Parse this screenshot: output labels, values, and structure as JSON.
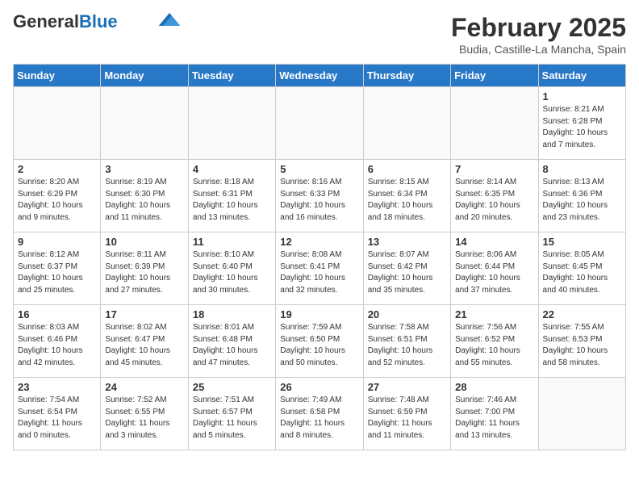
{
  "header": {
    "logo_general": "General",
    "logo_blue": "Blue",
    "month_title": "February 2025",
    "location": "Budia, Castille-La Mancha, Spain"
  },
  "weekdays": [
    "Sunday",
    "Monday",
    "Tuesday",
    "Wednesday",
    "Thursday",
    "Friday",
    "Saturday"
  ],
  "weeks": [
    [
      {
        "day": "",
        "info": ""
      },
      {
        "day": "",
        "info": ""
      },
      {
        "day": "",
        "info": ""
      },
      {
        "day": "",
        "info": ""
      },
      {
        "day": "",
        "info": ""
      },
      {
        "day": "",
        "info": ""
      },
      {
        "day": "1",
        "info": "Sunrise: 8:21 AM\nSunset: 6:28 PM\nDaylight: 10 hours and 7 minutes."
      }
    ],
    [
      {
        "day": "2",
        "info": "Sunrise: 8:20 AM\nSunset: 6:29 PM\nDaylight: 10 hours and 9 minutes."
      },
      {
        "day": "3",
        "info": "Sunrise: 8:19 AM\nSunset: 6:30 PM\nDaylight: 10 hours and 11 minutes."
      },
      {
        "day": "4",
        "info": "Sunrise: 8:18 AM\nSunset: 6:31 PM\nDaylight: 10 hours and 13 minutes."
      },
      {
        "day": "5",
        "info": "Sunrise: 8:16 AM\nSunset: 6:33 PM\nDaylight: 10 hours and 16 minutes."
      },
      {
        "day": "6",
        "info": "Sunrise: 8:15 AM\nSunset: 6:34 PM\nDaylight: 10 hours and 18 minutes."
      },
      {
        "day": "7",
        "info": "Sunrise: 8:14 AM\nSunset: 6:35 PM\nDaylight: 10 hours and 20 minutes."
      },
      {
        "day": "8",
        "info": "Sunrise: 8:13 AM\nSunset: 6:36 PM\nDaylight: 10 hours and 23 minutes."
      }
    ],
    [
      {
        "day": "9",
        "info": "Sunrise: 8:12 AM\nSunset: 6:37 PM\nDaylight: 10 hours and 25 minutes."
      },
      {
        "day": "10",
        "info": "Sunrise: 8:11 AM\nSunset: 6:39 PM\nDaylight: 10 hours and 27 minutes."
      },
      {
        "day": "11",
        "info": "Sunrise: 8:10 AM\nSunset: 6:40 PM\nDaylight: 10 hours and 30 minutes."
      },
      {
        "day": "12",
        "info": "Sunrise: 8:08 AM\nSunset: 6:41 PM\nDaylight: 10 hours and 32 minutes."
      },
      {
        "day": "13",
        "info": "Sunrise: 8:07 AM\nSunset: 6:42 PM\nDaylight: 10 hours and 35 minutes."
      },
      {
        "day": "14",
        "info": "Sunrise: 8:06 AM\nSunset: 6:44 PM\nDaylight: 10 hours and 37 minutes."
      },
      {
        "day": "15",
        "info": "Sunrise: 8:05 AM\nSunset: 6:45 PM\nDaylight: 10 hours and 40 minutes."
      }
    ],
    [
      {
        "day": "16",
        "info": "Sunrise: 8:03 AM\nSunset: 6:46 PM\nDaylight: 10 hours and 42 minutes."
      },
      {
        "day": "17",
        "info": "Sunrise: 8:02 AM\nSunset: 6:47 PM\nDaylight: 10 hours and 45 minutes."
      },
      {
        "day": "18",
        "info": "Sunrise: 8:01 AM\nSunset: 6:48 PM\nDaylight: 10 hours and 47 minutes."
      },
      {
        "day": "19",
        "info": "Sunrise: 7:59 AM\nSunset: 6:50 PM\nDaylight: 10 hours and 50 minutes."
      },
      {
        "day": "20",
        "info": "Sunrise: 7:58 AM\nSunset: 6:51 PM\nDaylight: 10 hours and 52 minutes."
      },
      {
        "day": "21",
        "info": "Sunrise: 7:56 AM\nSunset: 6:52 PM\nDaylight: 10 hours and 55 minutes."
      },
      {
        "day": "22",
        "info": "Sunrise: 7:55 AM\nSunset: 6:53 PM\nDaylight: 10 hours and 58 minutes."
      }
    ],
    [
      {
        "day": "23",
        "info": "Sunrise: 7:54 AM\nSunset: 6:54 PM\nDaylight: 11 hours and 0 minutes."
      },
      {
        "day": "24",
        "info": "Sunrise: 7:52 AM\nSunset: 6:55 PM\nDaylight: 11 hours and 3 minutes."
      },
      {
        "day": "25",
        "info": "Sunrise: 7:51 AM\nSunset: 6:57 PM\nDaylight: 11 hours and 5 minutes."
      },
      {
        "day": "26",
        "info": "Sunrise: 7:49 AM\nSunset: 6:58 PM\nDaylight: 11 hours and 8 minutes."
      },
      {
        "day": "27",
        "info": "Sunrise: 7:48 AM\nSunset: 6:59 PM\nDaylight: 11 hours and 11 minutes."
      },
      {
        "day": "28",
        "info": "Sunrise: 7:46 AM\nSunset: 7:00 PM\nDaylight: 11 hours and 13 minutes."
      },
      {
        "day": "",
        "info": ""
      }
    ]
  ]
}
